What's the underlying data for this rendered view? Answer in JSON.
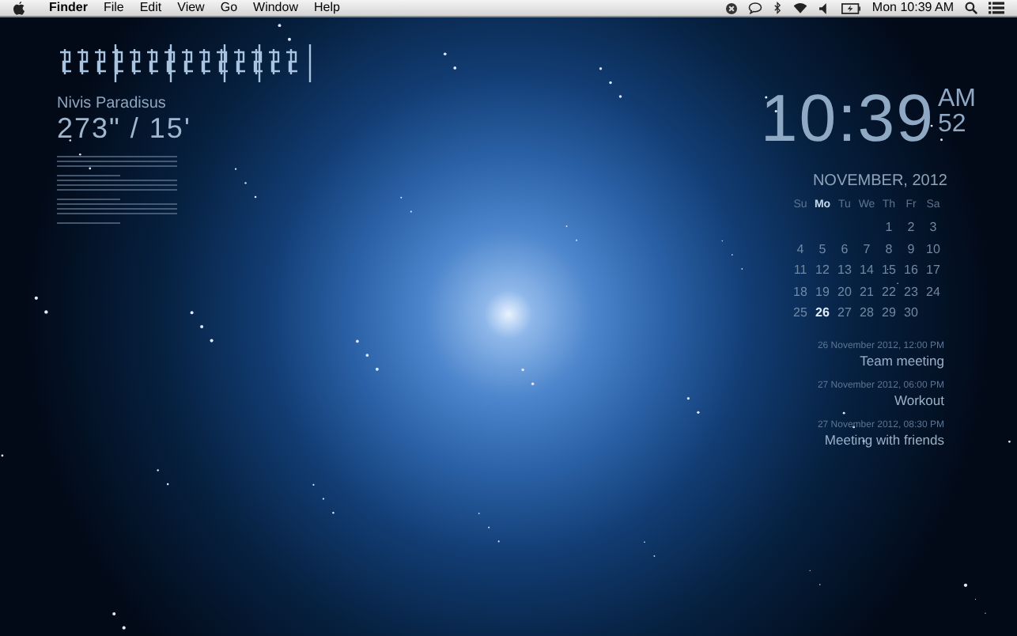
{
  "menu_bar": {
    "app_name": "Finder",
    "menus": [
      "File",
      "Edit",
      "View",
      "Go",
      "Window",
      "Help"
    ],
    "clock": "Mon 10:39 AM"
  },
  "location_widget": {
    "title": "Nivis Paradisus",
    "coordinates": "273\" / 15'"
  },
  "clock_widget": {
    "time": "10:39",
    "period": "AM",
    "seconds": "52"
  },
  "calendar": {
    "month": "NOVEMBER, 2012",
    "weekdays": [
      {
        "label": "Su",
        "selected": false
      },
      {
        "label": "Mo",
        "selected": true
      },
      {
        "label": "Tu",
        "selected": false
      },
      {
        "label": "We",
        "selected": false
      },
      {
        "label": "Th",
        "selected": false
      },
      {
        "label": "Fr",
        "selected": false
      },
      {
        "label": "Sa",
        "selected": false
      }
    ],
    "days": [
      {
        "day": "1",
        "selected": false
      },
      {
        "day": "2",
        "selected": false
      },
      {
        "day": "3",
        "selected": false
      },
      {
        "day": "4",
        "selected": false
      },
      {
        "day": "5",
        "selected": false
      },
      {
        "day": "6",
        "selected": false
      },
      {
        "day": "7",
        "selected": false
      },
      {
        "day": "8",
        "selected": false
      },
      {
        "day": "9",
        "selected": false
      },
      {
        "day": "10",
        "selected": false
      },
      {
        "day": "11",
        "selected": false
      },
      {
        "day": "12",
        "selected": false
      },
      {
        "day": "13",
        "selected": false
      },
      {
        "day": "14",
        "selected": false
      },
      {
        "day": "15",
        "selected": false
      },
      {
        "day": "16",
        "selected": false
      },
      {
        "day": "17",
        "selected": false
      },
      {
        "day": "18",
        "selected": false
      },
      {
        "day": "19",
        "selected": false
      },
      {
        "day": "20",
        "selected": false
      },
      {
        "day": "21",
        "selected": false
      },
      {
        "day": "22",
        "selected": false
      },
      {
        "day": "23",
        "selected": false
      },
      {
        "day": "24",
        "selected": false
      },
      {
        "day": "25",
        "selected": false
      },
      {
        "day": "26",
        "selected": true
      },
      {
        "day": "27",
        "selected": false
      },
      {
        "day": "28",
        "selected": false
      },
      {
        "day": "29",
        "selected": false
      },
      {
        "day": "30",
        "selected": false
      }
    ]
  },
  "events": [
    {
      "when": "26 November 2012, 12:00 PM",
      "title": "Team meeting"
    },
    {
      "when": "27 November 2012, 06:00 PM",
      "title": "Workout"
    },
    {
      "when": "27 November 2012, 08:30 PM",
      "title": "Meeting with friends"
    }
  ]
}
